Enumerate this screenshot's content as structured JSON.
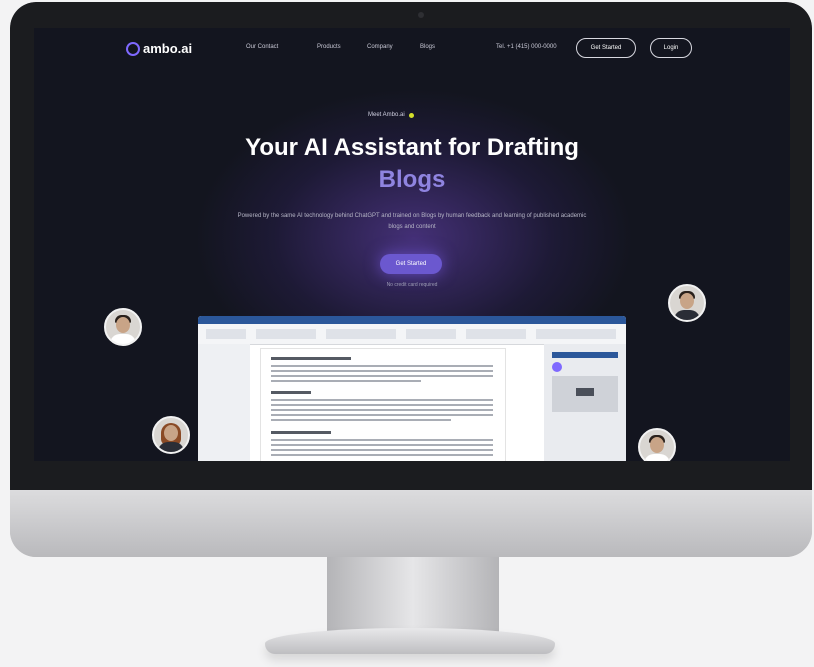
{
  "brand": {
    "name": "ambo.ai",
    "accent": "#7f69ff",
    "cta_color": "#6b58cf",
    "highlight": "#8f84e0"
  },
  "nav": {
    "links": [
      "Our Contact",
      "Products",
      "Company",
      "Blogs"
    ],
    "phone": "Tel. +1 (415) 000-0000",
    "signin_label": "Get Started",
    "login_label": "Login"
  },
  "hero": {
    "badge": "Meet Ambo.ai",
    "title": "Your AI Assistant for Drafting",
    "title_highlight": "Blogs",
    "description": "Powered by the same AI technology behind ChatGPT and trained on Blogs by human feedback and learning of published academic blogs and content",
    "cta_label": "Get Started",
    "cta_note": "No credit card required"
  },
  "icons": [
    "logo-ring-icon",
    "badge-dot-icon"
  ]
}
